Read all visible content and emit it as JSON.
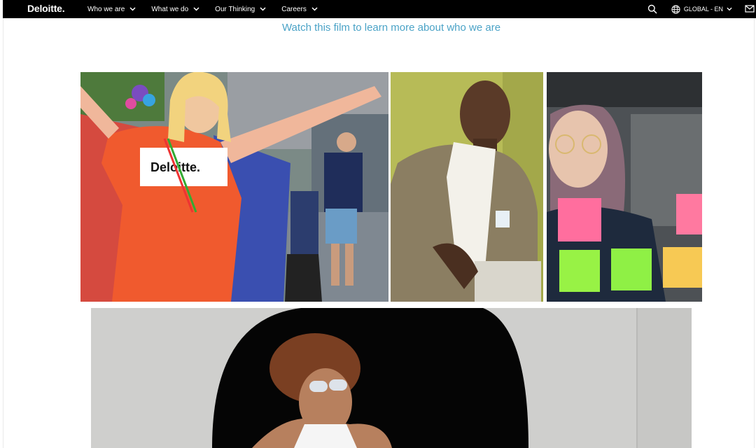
{
  "nav": {
    "logo": "Deloitte.",
    "items": [
      {
        "label": "Who we are"
      },
      {
        "label": "What we do"
      },
      {
        "label": "Our Thinking"
      },
      {
        "label": "Careers"
      }
    ],
    "language": "GLOBAL - EN",
    "icons": [
      "search-icon",
      "globe-icon",
      "chevron-down-icon",
      "contact-icon"
    ]
  },
  "main": {
    "film_link": "Watch this film to learn more about who we are"
  },
  "colors": {
    "nav_bg": "#000000",
    "link": "#4ba3c7"
  }
}
